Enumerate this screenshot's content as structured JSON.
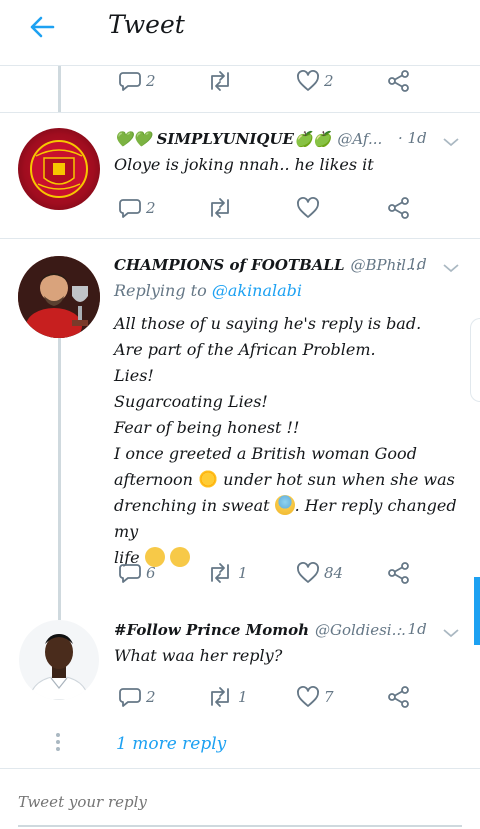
{
  "header": {
    "title": "Tweet"
  },
  "first_actions": {
    "reply_count": "2",
    "retweet_count": "",
    "like_count": "2"
  },
  "tweets": [
    {
      "name": "💚💚 SIMPLYUNIQUE🍏🍏",
      "handle": "@Af...",
      "time": "· 1d",
      "avatar_text": "MANCHESTER UNITED",
      "body_lines": [
        "Oloye is joking nnah.. he likes it"
      ],
      "reply_count": "2",
      "retweet_count": "",
      "like_count": ""
    },
    {
      "name": "CHAMPIONS of FOOTBALL",
      "handle": "@BPhil...",
      "time": "· 1d",
      "replying_label": "Replying to",
      "replying_to": "@akinalabi",
      "body_lines": [
        "All those of u saying he's reply is bad.",
        "Are part of the African Problem.",
        "Lies!",
        "Sugarcoating Lies!",
        "Fear of being honest !!",
        "I once greeted a British woman Good",
        "afternoon",
        "under hot sun when she was",
        "drenching in sweat",
        ". Her reply changed my",
        "life"
      ],
      "reply_count": "6",
      "retweet_count": "1",
      "like_count": "84"
    },
    {
      "name": "#Follow Prince Momoh",
      "handle": "@Goldiesi...",
      "time": "· 1d",
      "body_lines": [
        "What waa her reply?"
      ],
      "reply_count": "2",
      "retweet_count": "1",
      "like_count": "7"
    }
  ],
  "more_replies": "1 more reply",
  "reply_input": {
    "placeholder": "Tweet your reply"
  },
  "colors": {
    "accent": "#1da1f2",
    "muted": "#657786",
    "border": "#e1e8ed"
  }
}
